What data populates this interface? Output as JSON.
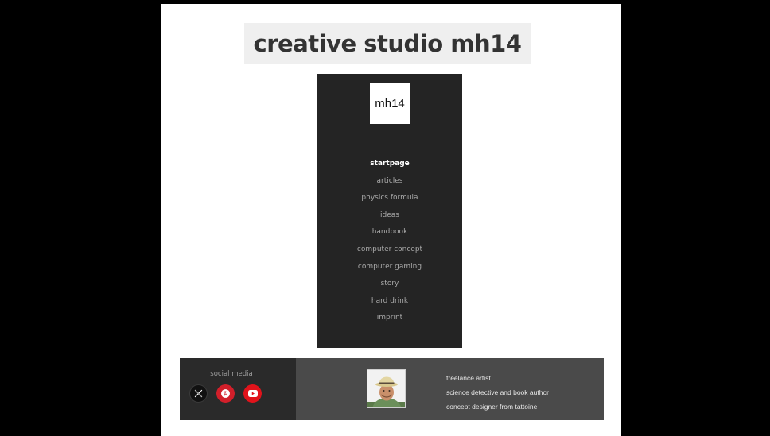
{
  "site": {
    "title": "creative studio mh14"
  },
  "nav": {
    "logo_text": "mh14",
    "items": [
      {
        "label": "startpage"
      },
      {
        "label": "articles"
      },
      {
        "label": "physics formula"
      },
      {
        "label": "ideas"
      },
      {
        "label": "handbook"
      },
      {
        "label": "computer concept"
      },
      {
        "label": "computer gaming"
      },
      {
        "label": "story"
      },
      {
        "label": "hard drink"
      },
      {
        "label": "imprint"
      }
    ],
    "active_index": 0
  },
  "footer": {
    "social_label": "social media",
    "social_icons": [
      "x-icon",
      "pinterest-icon",
      "youtube-icon"
    ],
    "bio_lines": [
      "freelance artist",
      "science detective and book author",
      "concept designer from tattoine"
    ]
  },
  "colors": {
    "page_background": "#ffffff",
    "letterbox": "#000000",
    "nav_panel": "#242424",
    "social_panel": "#2a2a2a",
    "bio_panel": "#4a4a4a",
    "pinterest": "#d21f2a",
    "youtube": "#e1131b"
  }
}
